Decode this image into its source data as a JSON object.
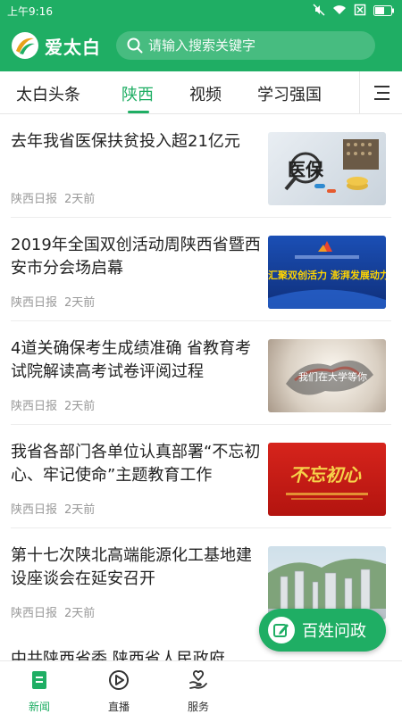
{
  "status_bar": {
    "time": "上午9:16"
  },
  "header": {
    "app_name": "爱太白",
    "search": {
      "placeholder": "请输入搜索关键字",
      "value": ""
    }
  },
  "tabs": [
    {
      "label": "太白头条",
      "active": false
    },
    {
      "label": "陕西",
      "active": true
    },
    {
      "label": "视频",
      "active": false
    },
    {
      "label": "学习强国",
      "active": false
    }
  ],
  "feed": [
    {
      "title": "去年我省医保扶贫投入超21亿元",
      "source": "陕西日报",
      "time": "2天前",
      "thumb_text": "医保"
    },
    {
      "title": "2019年全国双创活动周陕西省暨西安市分会场启幕",
      "source": "陕西日报",
      "time": "2天前",
      "thumb_text": "汇聚双创活力 澎湃发展动力"
    },
    {
      "title": "4道关确保考生成绩准确 省教育考试院解读高考试卷评阅过程",
      "source": "陕西日报",
      "time": "2天前",
      "thumb_text": "我们在大学等你"
    },
    {
      "title": "我省各部门各单位认真部署“不忘初心、牢记使命”主题教育工作",
      "source": "陕西日报",
      "time": "2天前",
      "thumb_text": "不忘初心"
    },
    {
      "title": "第十七次陕北高端能源化工基地建设座谈会在延安召开",
      "source": "陕西日报",
      "time": "2天前",
      "thumb_text": ""
    }
  ],
  "partial_item_title": "中共陕西省委 陕西省人民政府",
  "fab": {
    "label": "百姓问政"
  },
  "bottom_nav": [
    {
      "label": "新闻",
      "active": true
    },
    {
      "label": "直播",
      "active": false
    },
    {
      "label": "服务",
      "active": false
    }
  ],
  "colors": {
    "brand_green": "#1fae64"
  }
}
